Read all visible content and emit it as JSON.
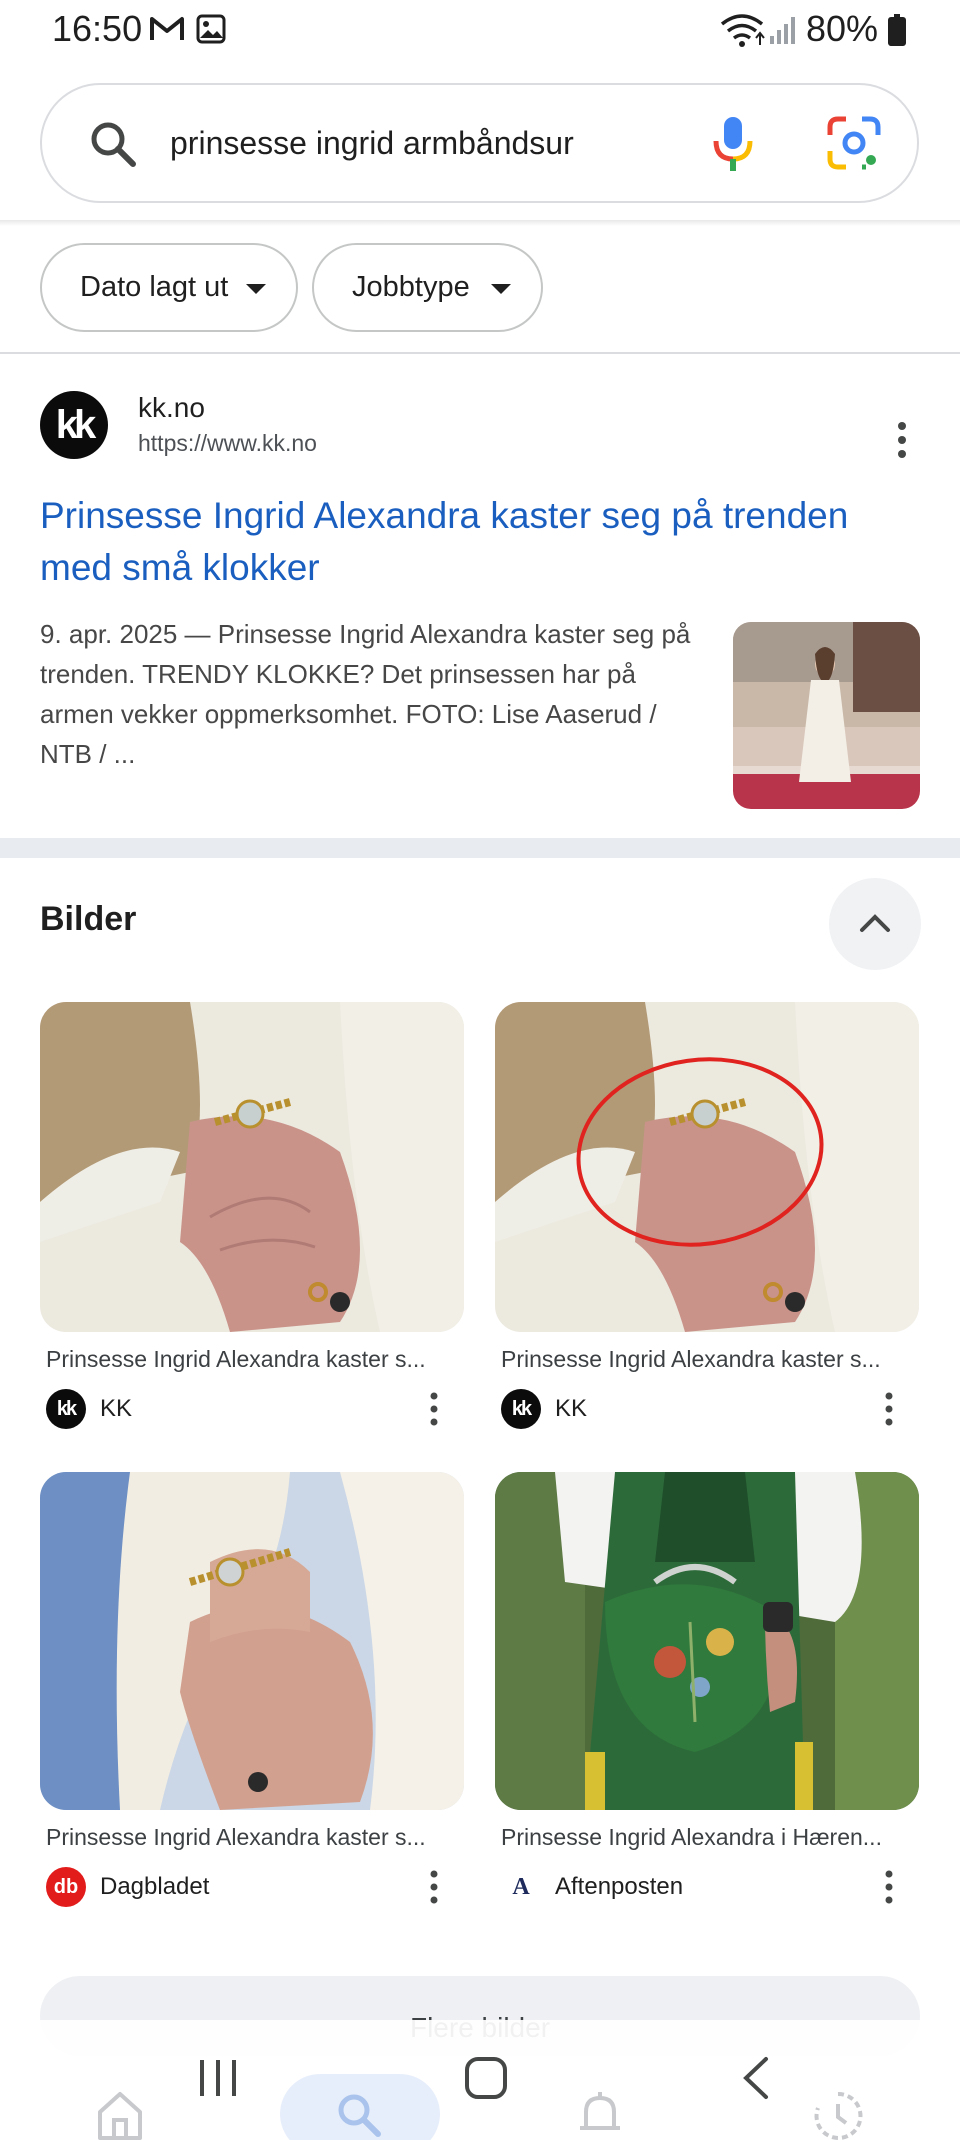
{
  "status_bar": {
    "time": "16:50",
    "battery": "80%",
    "icons": [
      "gmail-icon",
      "gallery-icon",
      "wifi-icon",
      "signal-icon",
      "battery-icon"
    ]
  },
  "search": {
    "query": "prinsesse ingrid armbåndsur",
    "icons": [
      "search-icon",
      "mic-icon",
      "lens-icon"
    ]
  },
  "filters": [
    {
      "label": "Dato lagt ut"
    },
    {
      "label": "Jobbtype"
    }
  ],
  "result": {
    "favicon_text": "kk",
    "site": "kk.no",
    "url": "https://www.kk.no",
    "title": "Prinsesse Ingrid Alexandra kaster seg på trenden med små klokker",
    "snippet": "9. apr. 2025 — Prinsesse Ingrid Alexandra kaster seg på trenden. TRENDY KLOKKE? Det prinsessen har på armen vekker oppmerksomhet. FOTO: Lise Aaserud / NTB / ..."
  },
  "images_section": {
    "title": "Bilder",
    "cards": [
      {
        "caption": "Prinsesse Ingrid Alexandra kaster s...",
        "source": "KK",
        "favicon": "kk-logo-icon"
      },
      {
        "caption": "Prinsesse Ingrid Alexandra kaster s...",
        "source": "KK",
        "favicon": "kk-logo-icon"
      },
      {
        "caption": "Prinsesse Ingrid Alexandra kaster s...",
        "source": "Dagbladet",
        "favicon": "dagbladet-logo-icon"
      },
      {
        "caption": "Prinsesse Ingrid Alexandra i Hæren...",
        "source": "Aftenposten",
        "favicon": "aftenposten-logo-icon"
      }
    ],
    "more_label": "Flere bilder"
  },
  "bottom_nav": {
    "items": [
      "home-icon",
      "search-icon",
      "notifications-icon",
      "history-icon"
    ],
    "active": "search-icon"
  },
  "colors": {
    "link": "#1a5fc0",
    "chip_border": "#c4c7c5",
    "band": "#e8ebef"
  }
}
